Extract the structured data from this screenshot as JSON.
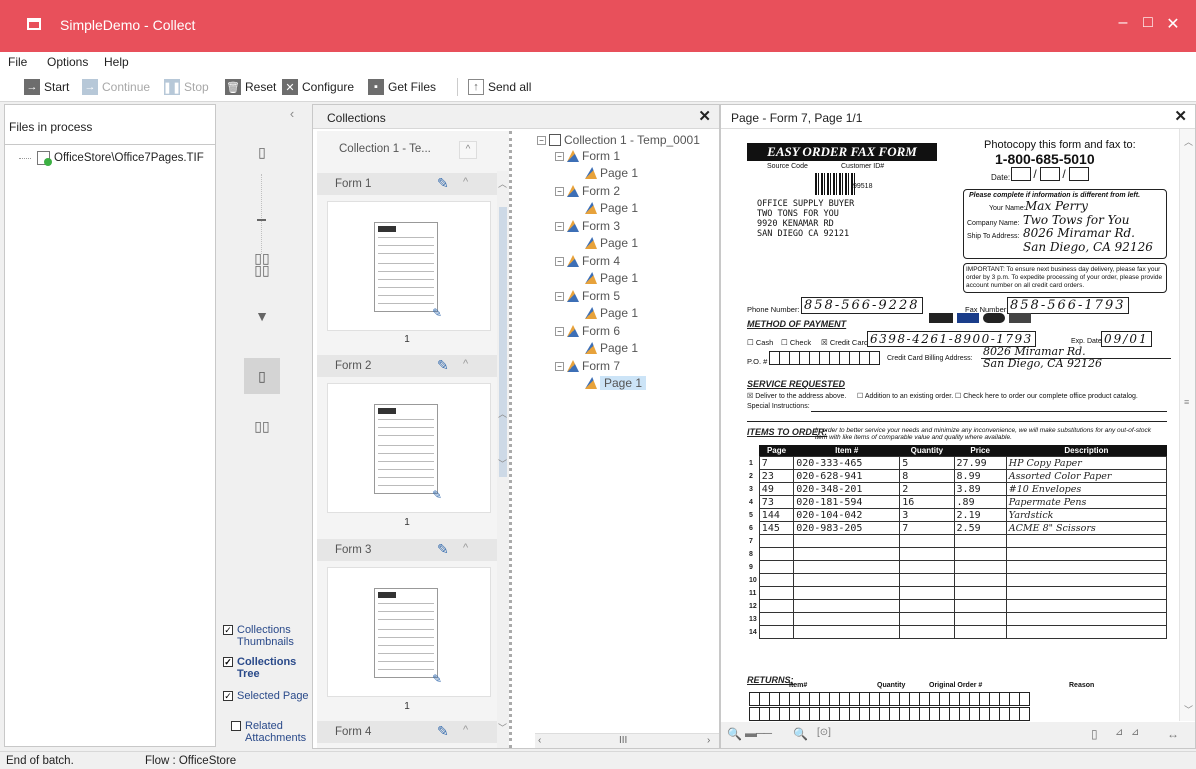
{
  "window": {
    "title": "SimpleDemo - Collect",
    "minimize": "–",
    "maximize": "□",
    "close": "✕"
  },
  "menu": [
    "File",
    "Options",
    "Help"
  ],
  "toolbar": {
    "start": "Start",
    "continue": "Continue",
    "stop": "Stop",
    "reset": "Reset",
    "configure": "Configure",
    "get_files": "Get Files",
    "send_all": "Send all"
  },
  "files_panel": {
    "header": "Files in process",
    "file": "OfficeStore\\Office7Pages.TIF"
  },
  "sidebar": {
    "checks": [
      {
        "label": "Collections Thumbnails",
        "checked": true
      },
      {
        "label": "Collections Tree",
        "checked": true
      },
      {
        "label": "Selected Page",
        "checked": true
      },
      {
        "label": "Related Attachments",
        "checked": false
      }
    ]
  },
  "collections": {
    "title": "Collections",
    "collection_label": "Collection 1 - Te...",
    "forms": [
      {
        "label": "Form 1",
        "page": "1"
      },
      {
        "label": "Form 2",
        "page": "1"
      },
      {
        "label": "Form 3",
        "page": "1"
      },
      {
        "label": "Form 4",
        "page": ""
      }
    ],
    "tree": {
      "root": "Collection 1 - Temp_0001",
      "forms": [
        "Form 1",
        "Form 2",
        "Form 3",
        "Form 4",
        "Form 5",
        "Form 6",
        "Form 7"
      ],
      "page_label": "Page 1",
      "selected": "Form 7 / Page 1"
    },
    "hscroll_mid": "III"
  },
  "viewer": {
    "title": "Page - Form 7, Page 1/1",
    "form": {
      "photocopy": "Photocopy this form and fax to:",
      "fax_phone": "1-800-685-5010",
      "banner": "EASY ORDER FAX FORM",
      "source_code": "Source Code",
      "customer_id": "Customer ID#",
      "barcode_num": "99518",
      "address_lines": [
        "OFFICE SUPPLY BUYER",
        "TWO TONS FOR YOU",
        "9920 KENAMAR RD",
        "SAN DIEGO CA 92121"
      ],
      "date_label": "Date:",
      "please_complete": "Please complete if information is different from left.",
      "your_name": "Your Name:",
      "your_name_val": "Max Perry",
      "company_name": "Company Name:",
      "company_val": "Two Tows for You",
      "ship_to": "Ship To Address:",
      "ship_val_1": "8026 Miramar Rd.",
      "ship_val_2": "San Diego, CA 92126",
      "important": "IMPORTANT: To ensure next business day delivery, please fax your order by 3 p.m. To expedite processing of your order, please provide account number on all credit card orders.",
      "phone_label": "Phone Number:",
      "phone_val": "858-566-9228",
      "fax_label": "Fax Number:",
      "fax_val": "858-566-1793",
      "method": "METHOD OF PAYMENT",
      "cash": "Cash",
      "check": "Check",
      "credit_card": "Credit Card",
      "card_val": "6398-4261-8900-1793",
      "exp_label": "Exp. Date",
      "exp_val": "09/01",
      "po_label": "P.O. #",
      "billing_label": "Credit Card Billing Address:",
      "billing_1": "8026 Miramar Rd.",
      "billing_2": "San Diego, CA 92126",
      "service": "SERVICE REQUESTED",
      "deliver": "Deliver to the address above.",
      "addition": "Addition to an existing order.",
      "catalog": "Check here to order our complete office product catalog.",
      "special": "Special Instructions:",
      "items_title": "ITEMS TO ORDER:",
      "items_note": "In order to better service your needs and minimize any inconvenience, we will make substitutions for any out-of-stock item with like items of comparable value and quality where available.",
      "cols": [
        "Page",
        "Item #",
        "Quantity",
        "Price",
        "Description"
      ],
      "rows": [
        {
          "n": "1",
          "page": "7",
          "item": "020-333-465",
          "qty": "5",
          "price": "27.99",
          "desc": "HP Copy Paper"
        },
        {
          "n": "2",
          "page": "23",
          "item": "020-628-941",
          "qty": "8",
          "price": "8.99",
          "desc": "Assorted Color Paper"
        },
        {
          "n": "3",
          "page": "49",
          "item": "020-348-201",
          "qty": "2",
          "price": "3.89",
          "desc": "#10 Envelopes"
        },
        {
          "n": "4",
          "page": "73",
          "item": "020-181-594",
          "qty": "16",
          "price": ".89",
          "desc": "Papermate Pens"
        },
        {
          "n": "5",
          "page": "144",
          "item": "020-104-042",
          "qty": "3",
          "price": "2.19",
          "desc": "Yardstick"
        },
        {
          "n": "6",
          "page": "145",
          "item": "020-983-205",
          "qty": "7",
          "price": "2.59",
          "desc": "ACME 8\" Scissors"
        },
        {
          "n": "7",
          "page": "",
          "item": "",
          "qty": "",
          "price": "",
          "desc": ""
        },
        {
          "n": "8",
          "page": "",
          "item": "",
          "qty": "",
          "price": "",
          "desc": ""
        },
        {
          "n": "9",
          "page": "",
          "item": "",
          "qty": "",
          "price": "",
          "desc": ""
        },
        {
          "n": "10",
          "page": "",
          "item": "",
          "qty": "",
          "price": "",
          "desc": ""
        },
        {
          "n": "11",
          "page": "",
          "item": "",
          "qty": "",
          "price": "",
          "desc": ""
        },
        {
          "n": "12",
          "page": "",
          "item": "",
          "qty": "",
          "price": "",
          "desc": ""
        },
        {
          "n": "13",
          "page": "",
          "item": "",
          "qty": "",
          "price": "",
          "desc": ""
        },
        {
          "n": "14",
          "page": "",
          "item": "",
          "qty": "",
          "price": "",
          "desc": ""
        }
      ],
      "returns": "RETURNS:",
      "ret_cols": [
        "Item#",
        "Quantity",
        "Original Order #",
        "Reason"
      ]
    }
  },
  "status": {
    "left": "End of batch.",
    "flow": "Flow : OfficeStore"
  }
}
